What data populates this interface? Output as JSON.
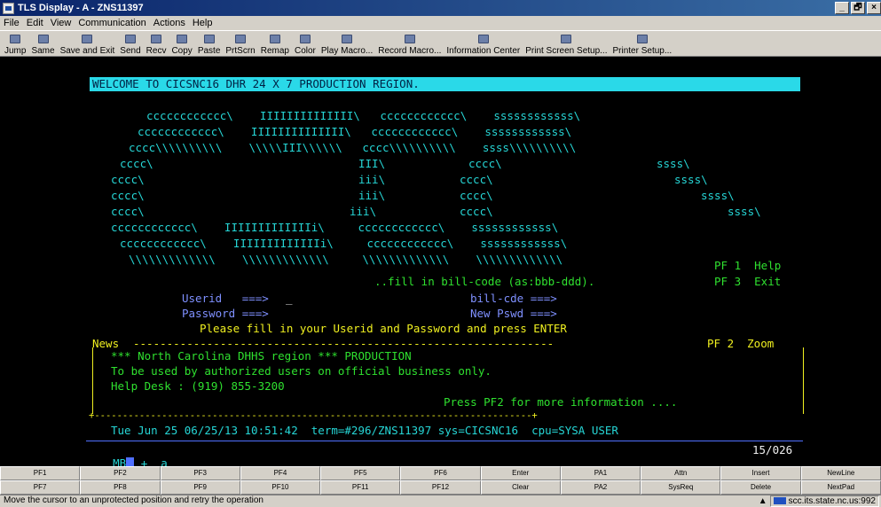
{
  "window": {
    "title": "TLS Display - A - ZNS11397",
    "buttons": [
      "_",
      "🗗",
      "×"
    ]
  },
  "menu": [
    "File",
    "Edit",
    "View",
    "Communication",
    "Actions",
    "Help"
  ],
  "toolbar": [
    {
      "label": "Jump",
      "icon": "jump-icon"
    },
    {
      "label": "Same",
      "icon": "same-icon"
    },
    {
      "label": "Save and Exit",
      "icon": "save-exit-icon"
    },
    {
      "label": "Send",
      "icon": "send-icon"
    },
    {
      "label": "Recv",
      "icon": "receive-icon"
    },
    {
      "label": "Copy",
      "icon": "copy-icon"
    },
    {
      "label": "Paste",
      "icon": "paste-icon"
    },
    {
      "label": "PrtScrn",
      "icon": "print-screen-icon"
    },
    {
      "label": "Remap",
      "icon": "remap-icon"
    },
    {
      "label": "Color",
      "icon": "color-icon"
    },
    {
      "label": "Play Macro...",
      "icon": "play-macro-icon"
    },
    {
      "label": "Record Macro...",
      "icon": "record-macro-icon"
    },
    {
      "label": "Information Center",
      "icon": "info-center-icon"
    },
    {
      "label": "Print Screen Setup...",
      "icon": "print-setup-icon"
    },
    {
      "label": "Printer Setup...",
      "icon": "printer-setup-icon"
    }
  ],
  "terminal": {
    "welcome": "WELCOME TO CICSNC16 DHR 24 X 7 PRODUCTION REGION.",
    "logo": [
      "cccccccccccc\\    IIIIIIIIIIIIII\\   cccccccccccc\\    ssssssssssss\\",
      "cccccccccccc\\    IIIIIIIIIIIIII\\   cccccccccccc\\    ssssssssssss\\",
      "cccc\\\\\\\\\\\\\\\\\\\\    \\\\\\\\\\III\\\\\\\\\\\\   cccc\\\\\\\\\\\\\\\\\\\\    ssss\\\\\\\\\\\\\\\\\\\\",
      "cccc\\",
      "cccc\\",
      "cccc\\",
      "cccc\\",
      "cccccccccccc\\    IIIIIIIIIIIIIi\\     cccccccccccc\\    ssssssssssss\\",
      "cccccccccccc\\    IIIIIIIIIIIIIi\\     cccccccccccc\\    ssssssssssss\\",
      "\\\\\\\\\\\\\\\\\\\\\\\\\\    \\\\\\\\\\\\\\\\\\\\\\\\\\     \\\\\\\\\\\\\\\\\\\\\\\\\\    \\\\\\\\\\\\\\\\\\\\\\\\\\"
    ],
    "logo_mid": {
      "row4_i": "III\\",
      "row4_c": "cccc\\",
      "row4_s": "ssss\\",
      "row5_i": "iii\\",
      "row5_c": "cccc\\",
      "row5_s": "ssss\\",
      "row6_i": "iii\\",
      "row6_c": "cccc\\",
      "row6_s": "ssss\\",
      "row7_i": "iii\\",
      "row7_c": "cccc\\",
      "row7_s": "ssss\\"
    },
    "pf1": "PF 1  Help",
    "pf3": "PF 3  Exit",
    "fill_billcode": "..fill in bill-code (as:bbb-ddd).",
    "userid_label": "Userid   ===>",
    "userid_cursor": "_",
    "password_label": "Password ===>",
    "billcde_label": "bill-cde ===>",
    "newpswd_label": "New Pswd ===>",
    "instruction": "Please fill in your Userid and Password and press ENTER",
    "news_label": "News",
    "news_dashes": "---------------------------------------------------------------",
    "pf2_zoom": "PF 2  Zoom",
    "news_lines": [
      "*** North Carolina DHHS region *** PRODUCTION",
      "To be used by authorized users on official business only.",
      "Help Desk : (919) 855-3200"
    ],
    "news_more": "Press PF2 for more information ....",
    "news_bottom": "+------------------------------------------------------------------------------+",
    "status_line": "Tue Jun 25 06/25/13 10:51:42  term=#296/ZNS11397 sys=CICSNC16  cpu=SYSA USER",
    "oia_left": "MB",
    "oia_plus": "+",
    "oia_a": "a",
    "cursor_pos": "15/026"
  },
  "keys_row1": [
    "PF1",
    "PF2",
    "PF3",
    "PF4",
    "PF5",
    "PF6",
    "Enter",
    "PA1",
    "Attn",
    "Insert",
    "NewLine"
  ],
  "keys_row2": [
    "PF7",
    "PF8",
    "PF9",
    "PF10",
    "PF11",
    "PF12",
    "Clear",
    "PA2",
    "SysReq",
    "Delete",
    "NextPad"
  ],
  "status": {
    "message": "Move the cursor to an unprotected position and retry the operation",
    "host": "scc.its.state.nc.us:992"
  },
  "colors": {
    "terminal_bg": "#000000",
    "cyan": "#26d6d6",
    "green": "#2fe02f",
    "yellow": "#f0f020",
    "welcome_bg": "#2ad9e8"
  }
}
